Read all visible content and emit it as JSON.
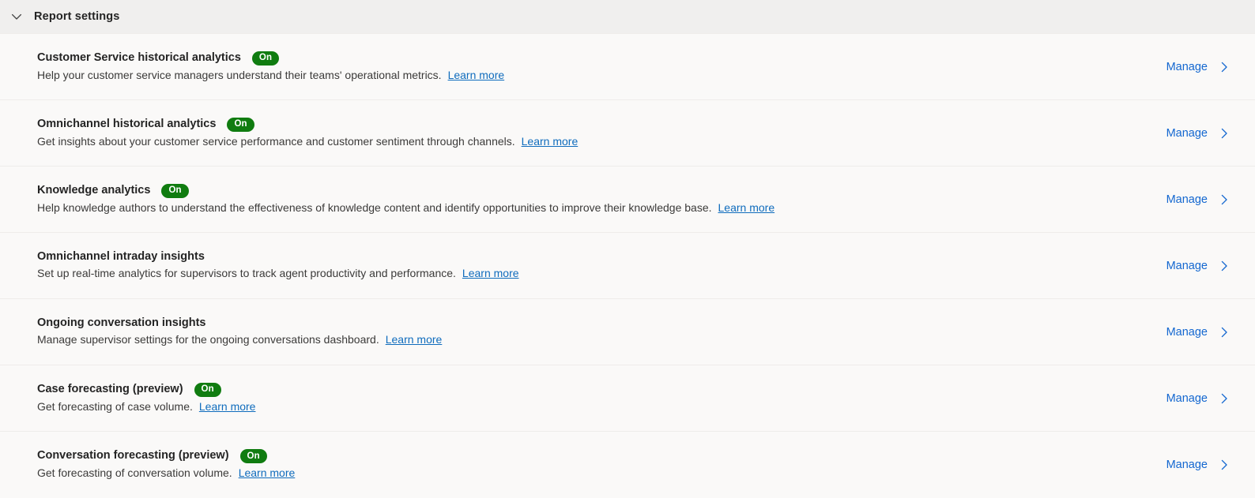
{
  "header": {
    "title": "Report settings",
    "collapse_icon": "chevron-down-icon"
  },
  "link_labels": {
    "learn_more": "Learn more",
    "manage": "Manage",
    "manage_icon": "chevron-right-icon"
  },
  "colors": {
    "badge_on": "#107c10",
    "link_blue": "#0f6cbd",
    "manage_blue": "#1367d0",
    "header_bg": "#f0efee",
    "body_bg": "#faf9f8",
    "row_divider": "#eeecea"
  },
  "rows": [
    {
      "title": "Customer Service historical analytics",
      "badge": "On",
      "description": "Help your customer service managers understand their teams' operational metrics.",
      "learn_more": "Learn more",
      "action": "Manage"
    },
    {
      "title": "Omnichannel historical analytics",
      "badge": "On",
      "description": "Get insights about your customer service performance and customer sentiment through channels.",
      "learn_more": "Learn more",
      "action": "Manage"
    },
    {
      "title": "Knowledge analytics",
      "badge": "On",
      "description": "Help knowledge authors to understand the effectiveness of knowledge content and identify opportunities to improve their knowledge base.",
      "learn_more": "Learn more",
      "action": "Manage"
    },
    {
      "title": "Omnichannel intraday insights",
      "badge": "",
      "description": "Set up real-time analytics for supervisors to track agent productivity and performance.",
      "learn_more": "Learn more",
      "action": "Manage"
    },
    {
      "title": "Ongoing conversation insights",
      "badge": "",
      "description": "Manage supervisor settings for the ongoing conversations dashboard.",
      "learn_more": "Learn more",
      "action": "Manage"
    },
    {
      "title": "Case forecasting (preview)",
      "badge": "On",
      "description": "Get forecasting of case volume.",
      "learn_more": "Learn more",
      "action": "Manage"
    },
    {
      "title": "Conversation forecasting (preview)",
      "badge": "On",
      "description": "Get forecasting of conversation volume.",
      "learn_more": "Learn more",
      "action": "Manage"
    }
  ]
}
